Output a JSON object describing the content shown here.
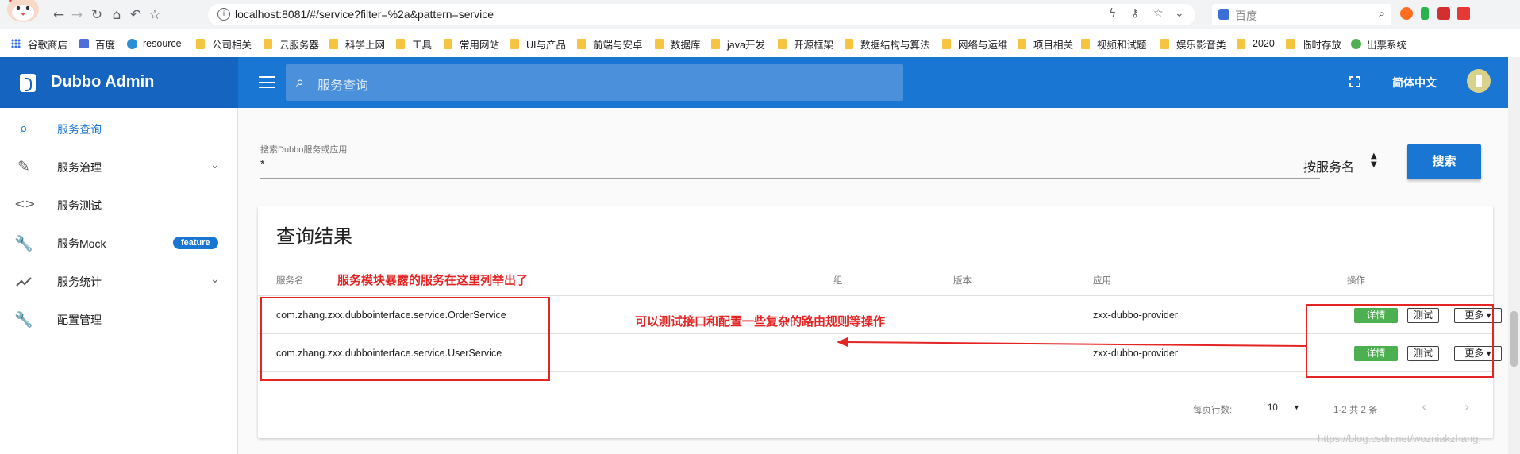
{
  "browser": {
    "url": "localhost:8081/#/service?filter=%2a&pattern=service",
    "search_placeholder": "百度",
    "bookmarks": [
      "谷歌商店",
      "百度",
      "resource",
      "公司相关",
      "云服务器",
      "科学上网",
      "工具",
      "常用网站",
      "UI与产品",
      "前端与安卓",
      "数据库",
      "java开发",
      "开源框架",
      "数据结构与算法",
      "网络与运维",
      "项目相关",
      "视频和试题",
      "娱乐影音类",
      "2020",
      "临时存放",
      "出票系统"
    ]
  },
  "app": {
    "title": "Dubbo Admin",
    "top_search_placeholder": "服务查询",
    "language": "简体中文"
  },
  "sidebar": {
    "items": [
      {
        "label": "服务查询",
        "icon": "search-icon",
        "active": true
      },
      {
        "label": "服务治理",
        "icon": "pencil-icon",
        "expandable": true
      },
      {
        "label": "服务测试",
        "icon": "code-icon"
      },
      {
        "label": "服务Mock",
        "icon": "wrench-icon",
        "badge": "feature"
      },
      {
        "label": "服务统计",
        "icon": "trending-icon",
        "expandable": true
      },
      {
        "label": "配置管理",
        "icon": "wrench-icon"
      }
    ]
  },
  "search": {
    "label": "搜索Dubbo服务或应用",
    "value": "*",
    "sort_by": "按服务名",
    "button": "搜索"
  },
  "results": {
    "title": "查询结果",
    "columns": [
      "服务名",
      "组",
      "版本",
      "应用",
      "操作"
    ],
    "rows": [
      {
        "service": "com.zhang.zxx.dubbointerface.service.OrderService",
        "group": "",
        "version": "",
        "app": "zxx-dubbo-provider"
      },
      {
        "service": "com.zhang.zxx.dubbointerface.service.UserService",
        "group": "",
        "version": "",
        "app": "zxx-dubbo-provider"
      }
    ],
    "actions": {
      "detail": "详情",
      "test": "测试",
      "more": "更多"
    },
    "rows_per_page_label": "每页行数:",
    "rows_per_page": "10",
    "range": "1-2 共 2 条"
  },
  "annotations": {
    "services_note": "服务模块暴露的服务在这里列举出了",
    "actions_note": "可以测试接口和配置一些复杂的路由规则等操作",
    "color": "#e52424"
  },
  "watermark": "https://blog.csdn.net/wozniakzhang"
}
